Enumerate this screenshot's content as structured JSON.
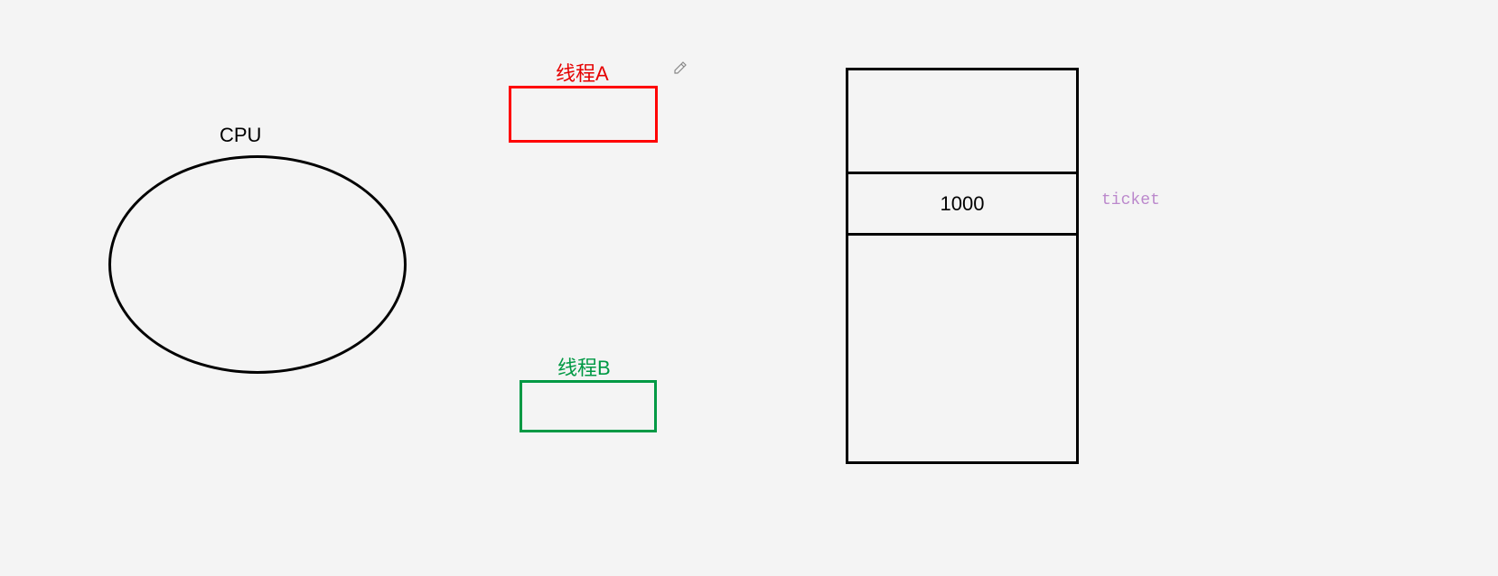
{
  "cpu": {
    "label": "CPU"
  },
  "threads": {
    "a": {
      "label": "线程A"
    },
    "b": {
      "label": "线程B"
    }
  },
  "memory": {
    "cells": [
      {
        "value": ""
      },
      {
        "value": "1000"
      },
      {
        "value": ""
      }
    ],
    "variable_label": "ticket"
  }
}
